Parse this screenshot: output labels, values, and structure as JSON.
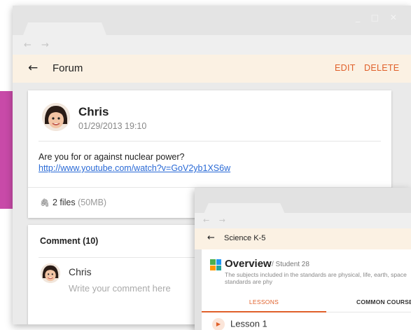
{
  "window_controls": "_ □ ✕",
  "nav_arrows": "← →",
  "forum": {
    "appbar": {
      "back_icon": "arrow-left-icon",
      "title": "Forum",
      "edit_label": "EDIT",
      "delete_label": "DELETE"
    },
    "post": {
      "author": "Chris",
      "date": "01/29/2013 19:10",
      "text": "Are you for or against nuclear power?",
      "link": "http://www.youtube.com/watch?v=GoV2yb1XS6w",
      "attachments": {
        "icon": "paperclip-icon",
        "count_label": "2 files",
        "size": "(50MB)"
      }
    },
    "comments": {
      "title": "Comment (10)",
      "user": "Chris",
      "placeholder": "Write your comment here"
    }
  },
  "course": {
    "appbar": {
      "back_icon": "arrow-left-icon",
      "title": "Science K-5"
    },
    "overview": {
      "title": "Overview",
      "subtitle": "/ Student 28",
      "description": "The subjects included in the standards are physical, life, earth, space standards are phy"
    },
    "tabs": [
      "LESSONS",
      "COMMON COURSE I"
    ],
    "active_tab": "LESSONS",
    "lessons": [
      "Lesson 1"
    ]
  },
  "colors": {
    "accent": "#e0602a",
    "appbar_bg": "#fbf1e3",
    "link": "#2a6ad6",
    "band": "#c84aa8"
  }
}
